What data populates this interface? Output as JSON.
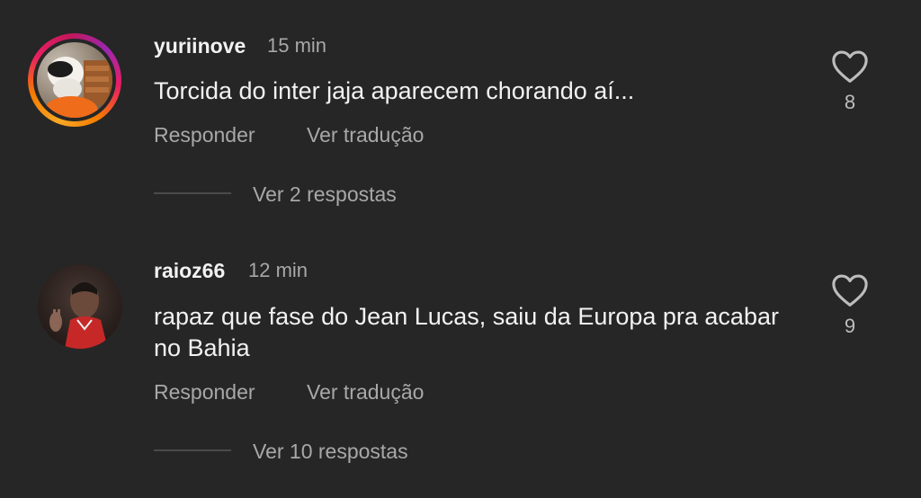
{
  "comments": [
    {
      "username": "yuriinove",
      "time": "15 min",
      "text": "Torcida do inter jaja aparecem chorando aí...",
      "reply_label": "Responder",
      "translate_label": "Ver tradução",
      "replies_label": "Ver 2 respostas",
      "likes": "8",
      "has_story_ring": true
    },
    {
      "username": "raioz66",
      "time": "12 min",
      "text": "rapaz que fase do Jean Lucas, saiu da Europa pra acabar no Bahia",
      "reply_label": "Responder",
      "translate_label": "Ver tradução",
      "replies_label": "Ver 10 respostas",
      "likes": "9",
      "has_story_ring": false
    }
  ],
  "icons": {
    "like": "heart-outline-icon"
  },
  "colors": {
    "background": "#262626",
    "primary_text": "#f2f2f2",
    "secondary_text": "#a8a8a8",
    "story_ring_start": "#f9a825",
    "story_ring_end": "#c2185b"
  }
}
